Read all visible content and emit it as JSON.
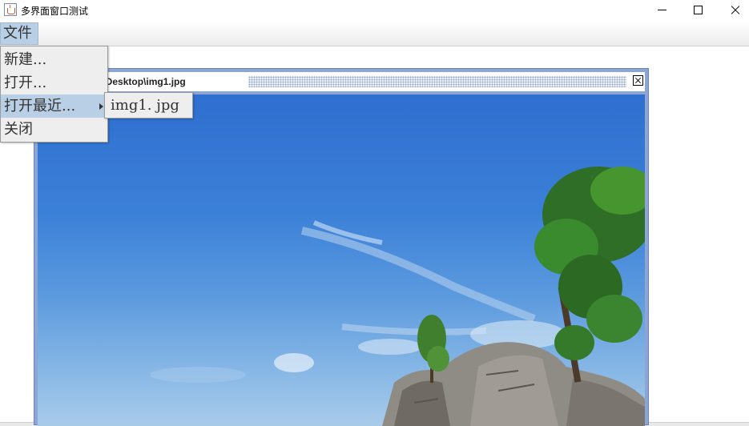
{
  "window": {
    "title": "多界面窗口测试",
    "icon": "java-cup-icon"
  },
  "menubar": {
    "items": [
      {
        "label": "文件",
        "active": true
      }
    ]
  },
  "file_menu": {
    "items": [
      {
        "label": "新建..."
      },
      {
        "label": "打开..."
      },
      {
        "label": "打开最近...",
        "has_submenu": true,
        "highlighted": true
      },
      {
        "label": "关闭"
      }
    ]
  },
  "recent_submenu": {
    "items": [
      {
        "label": "img1. jpg"
      }
    ]
  },
  "internal_frame": {
    "title": "C:\\Users\\LML\\Desktop\\img1.jpg",
    "close_icon": "close-icon"
  },
  "colors": {
    "menu_highlight": "#b8cfe5",
    "frame_border": "#8da5d4",
    "menu_background": "#eeeeee"
  }
}
